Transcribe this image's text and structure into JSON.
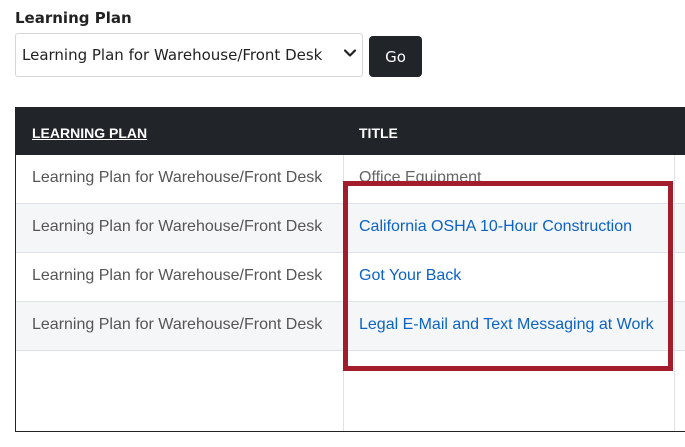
{
  "form": {
    "label": "Learning Plan",
    "select_value": "Learning Plan for Warehouse/Front Desk",
    "go_label": "Go"
  },
  "table": {
    "headers": {
      "plan": "LEARNING PLAN",
      "title": "TITLE"
    },
    "rows": [
      {
        "plan": "Learning Plan for Warehouse/Front Desk",
        "title": "Office Equipment"
      },
      {
        "plan": "Learning Plan for Warehouse/Front Desk",
        "title": "California OSHA 10-Hour Construction"
      },
      {
        "plan": "Learning Plan for Warehouse/Front Desk",
        "title": "Got Your Back"
      },
      {
        "plan": "Learning Plan for Warehouse/Front Desk",
        "title": "Legal E-Mail and Text Messaging at Work"
      }
    ]
  },
  "colors": {
    "header_bg": "#212529",
    "link": "#0b63c5",
    "highlight": "#a11d2b"
  },
  "icons": {
    "select_chevron": "chevron-down-icon"
  }
}
